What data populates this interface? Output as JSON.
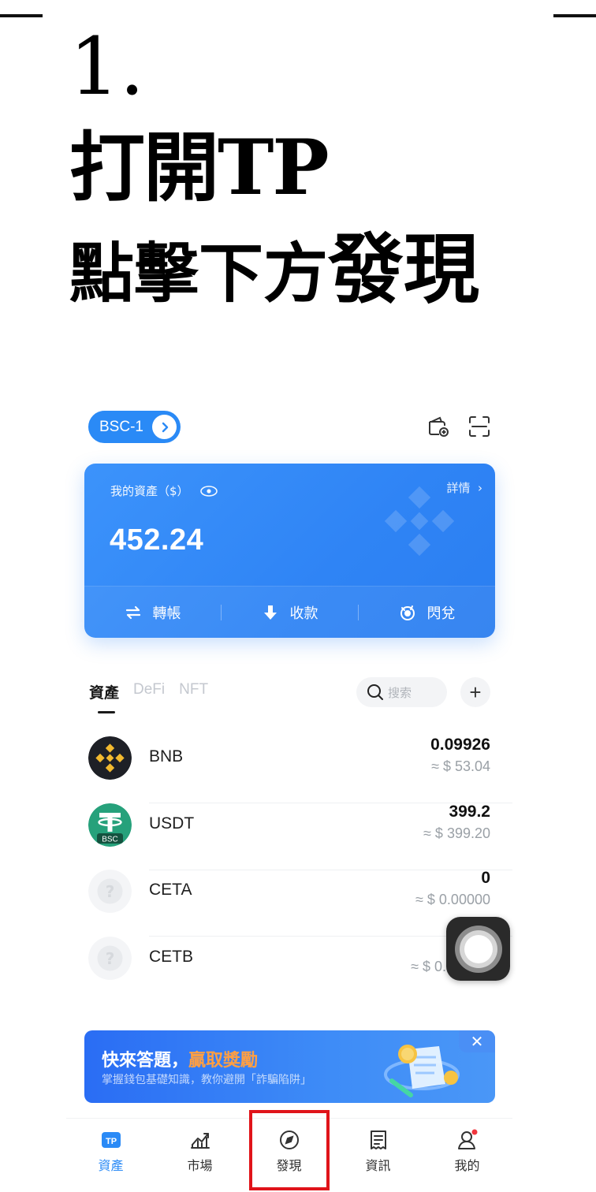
{
  "tutorial": {
    "step": "1.",
    "heading_line1": "打開TP",
    "heading_line2_part1": "點擊下方",
    "heading_line2_part2": "發現"
  },
  "header": {
    "chain_label": "BSC-1",
    "wallet_add_icon": "wallet-add-icon",
    "scan_icon": "scan-icon"
  },
  "asset_card": {
    "label": "我的資產（$）",
    "detail_label": "詳情",
    "balance": "452.24",
    "actions": [
      {
        "label": "轉帳",
        "icon": "transfer-icon"
      },
      {
        "label": "收款",
        "icon": "receive-icon"
      },
      {
        "label": "閃兌",
        "icon": "swap-icon"
      }
    ]
  },
  "tabs": {
    "assets": "資產",
    "defi": "DeFi",
    "nft": "NFT",
    "search_placeholder": "搜索"
  },
  "tokens": [
    {
      "name": "BNB",
      "amount": "0.09926",
      "value": "≈ $ 53.04"
    },
    {
      "name": "USDT",
      "amount": "399.2",
      "value": "≈ $ 399.20",
      "badge": "BSC"
    },
    {
      "name": "CETA",
      "amount": "0",
      "value": "≈ $ 0.00000"
    },
    {
      "name": "CETB",
      "amount": "",
      "value": "≈ $ 0."
    }
  ],
  "banner": {
    "title_part1": "快來答題，",
    "title_part2": "贏取獎勵",
    "subtitle": "掌握錢包基礎知識，教你避開「詐騙陷阱」",
    "close": "✕"
  },
  "bottom_nav": [
    {
      "label": "資產",
      "icon": "tp-icon",
      "active": true
    },
    {
      "label": "市場",
      "icon": "market-icon"
    },
    {
      "label": "發現",
      "icon": "compass-icon"
    },
    {
      "label": "資訊",
      "icon": "news-icon"
    },
    {
      "label": "我的",
      "icon": "profile-icon"
    }
  ],
  "colors": {
    "accent": "#2a8af6",
    "highlight": "#e0141a",
    "banner_accent": "#ff9f43",
    "bnb": "#f3ba2f",
    "usdt": "#26a17b"
  }
}
